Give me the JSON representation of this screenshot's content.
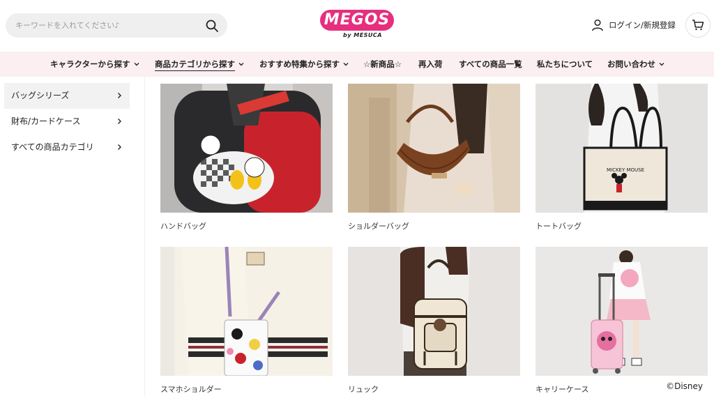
{
  "search": {
    "placeholder": "キーワードを入れてください♪",
    "value": ""
  },
  "logo": {
    "main": "MEGOS",
    "sub": "by MESUCA"
  },
  "header": {
    "account_label": "ログイン/新規登録"
  },
  "nav": {
    "items": [
      {
        "label": "キャラクターから探す",
        "has_dropdown": true
      },
      {
        "label": "商品カテゴリから探す",
        "has_dropdown": true,
        "active": true
      },
      {
        "label": "おすすめ特集から探す",
        "has_dropdown": true
      },
      {
        "label": "☆新商品☆",
        "has_dropdown": false
      },
      {
        "label": "再入荷",
        "has_dropdown": false
      },
      {
        "label": "すべての商品一覧",
        "has_dropdown": false
      },
      {
        "label": "私たちについて",
        "has_dropdown": false
      },
      {
        "label": "お問い合わせ",
        "has_dropdown": true
      }
    ]
  },
  "sidebar": {
    "items": [
      {
        "label": "バッグシリーズ",
        "active": true
      },
      {
        "label": "財布/カードケース",
        "active": false
      },
      {
        "label": "すべての商品カテゴリ",
        "active": false
      }
    ]
  },
  "products": [
    {
      "label": "ハンドバッグ"
    },
    {
      "label": "ショルダーバッグ"
    },
    {
      "label": "トートバッグ"
    },
    {
      "label": "スマホショルダー"
    },
    {
      "label": "リュック"
    },
    {
      "label": "キャリーケース"
    }
  ],
  "footer": {
    "copyright": "©Disney"
  },
  "colors": {
    "brand_pink": "#e62f7e",
    "nav_bg": "#fbeff2",
    "sidebar_active": "#f2f2f2"
  },
  "icons": {
    "search": "search-icon",
    "user": "user-icon",
    "cart": "cart-icon",
    "chevron": "chevron-down-icon",
    "chevron_right": "chevron-right-icon"
  }
}
